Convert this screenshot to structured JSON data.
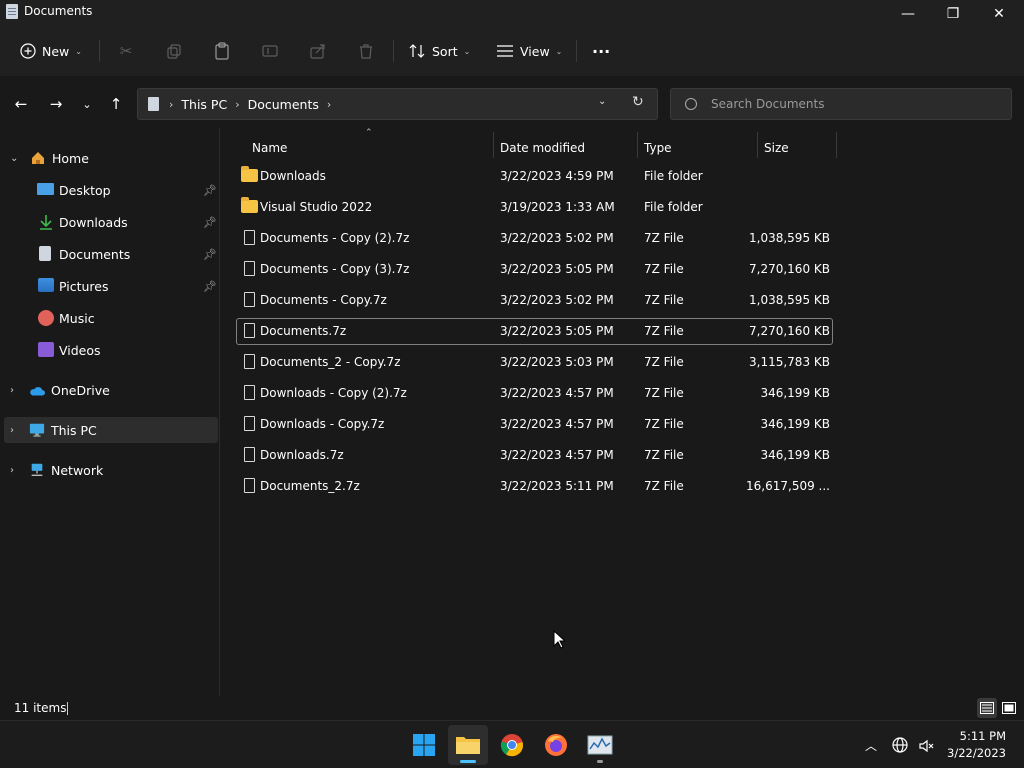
{
  "window": {
    "title": "Documents",
    "minimize": "—",
    "maximize": "❐",
    "close": "✕"
  },
  "commandbar": {
    "new_label": "New",
    "sort_label": "Sort",
    "view_label": "View",
    "more": "···"
  },
  "address": {
    "crumbs": [
      "This PC",
      "Documents"
    ],
    "search_placeholder": "Search Documents"
  },
  "sidebar": {
    "items": [
      {
        "label": "Home"
      },
      {
        "label": "Desktop"
      },
      {
        "label": "Downloads"
      },
      {
        "label": "Documents"
      },
      {
        "label": "Pictures"
      },
      {
        "label": "Music"
      },
      {
        "label": "Videos"
      },
      {
        "label": "OneDrive"
      },
      {
        "label": "This PC"
      },
      {
        "label": "Network"
      }
    ]
  },
  "columns": {
    "name": "Name",
    "date": "Date modified",
    "type": "Type",
    "size": "Size"
  },
  "files": [
    {
      "name": "Downloads",
      "date": "3/22/2023 4:59 PM",
      "type": "File folder",
      "size": ""
    },
    {
      "name": "Visual Studio 2022",
      "date": "3/19/2023 1:33 AM",
      "type": "File folder",
      "size": ""
    },
    {
      "name": "Documents - Copy (2).7z",
      "date": "3/22/2023 5:02 PM",
      "type": "7Z File",
      "size": "1,038,595 KB"
    },
    {
      "name": "Documents - Copy (3).7z",
      "date": "3/22/2023 5:05 PM",
      "type": "7Z File",
      "size": "7,270,160 KB"
    },
    {
      "name": "Documents - Copy.7z",
      "date": "3/22/2023 5:02 PM",
      "type": "7Z File",
      "size": "1,038,595 KB"
    },
    {
      "name": "Documents.7z",
      "date": "3/22/2023 5:05 PM",
      "type": "7Z File",
      "size": "7,270,160 KB"
    },
    {
      "name": "Documents_2 - Copy.7z",
      "date": "3/22/2023 5:03 PM",
      "type": "7Z File",
      "size": "3,115,783 KB"
    },
    {
      "name": "Downloads - Copy (2).7z",
      "date": "3/22/2023 4:57 PM",
      "type": "7Z File",
      "size": "346,199 KB"
    },
    {
      "name": "Downloads - Copy.7z",
      "date": "3/22/2023 4:57 PM",
      "type": "7Z File",
      "size": "346,199 KB"
    },
    {
      "name": "Downloads.7z",
      "date": "3/22/2023 4:57 PM",
      "type": "7Z File",
      "size": "346,199 KB"
    },
    {
      "name": "Documents_2.7z",
      "date": "3/22/2023 5:11 PM",
      "type": "7Z File",
      "size": "16,617,509 ..."
    }
  ],
  "status": {
    "count": "11 items"
  },
  "clock": {
    "time": "5:11 PM",
    "date": "3/22/2023"
  },
  "colors": {
    "accent": "#4cc2ff",
    "folder": "#f6c344",
    "background": "#191919"
  }
}
